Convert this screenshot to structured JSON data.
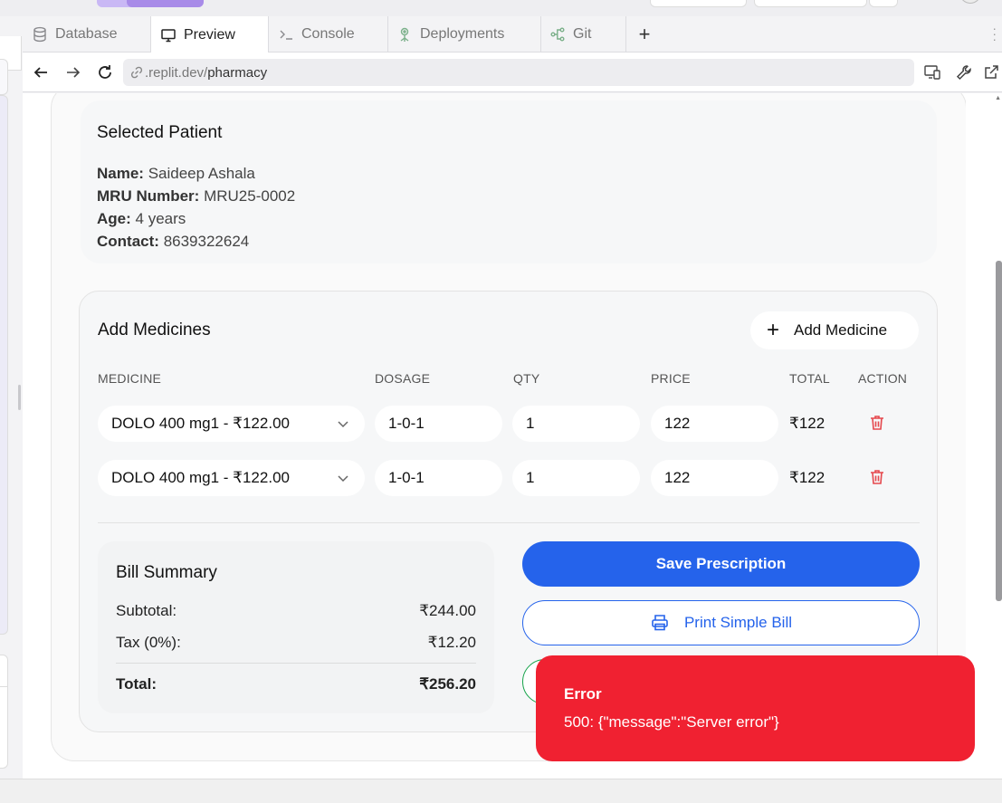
{
  "tabs": [
    {
      "label": "Database",
      "icon": "database-icon"
    },
    {
      "label": "Preview",
      "icon": "monitor-icon"
    },
    {
      "label": "Console",
      "icon": "terminal-icon"
    },
    {
      "label": "Deployments",
      "icon": "deployments-icon"
    },
    {
      "label": "Git",
      "icon": "git-icon"
    }
  ],
  "add_tab": "+",
  "browser": {
    "url_host": ".replit.dev/",
    "url_path": "pharmacy"
  },
  "patient": {
    "heading": "Selected Patient",
    "name_label": "Name:",
    "name": "Saideep Ashala",
    "mru_label": "MRU Number:",
    "mru": "MRU25-0002",
    "age_label": "Age:",
    "age": "4 years",
    "contact_label": "Contact:",
    "contact": "8639322624"
  },
  "medicines": {
    "heading": "Add Medicines",
    "add_button": "Add Medicine",
    "columns": [
      "MEDICINE",
      "DOSAGE",
      "QTY",
      "PRICE",
      "TOTAL",
      "ACTION"
    ],
    "rows": [
      {
        "medicine": "DOLO 400 mg1 - ₹122.00",
        "dosage": "1-0-1",
        "qty": "1",
        "price": "122",
        "total": "₹122"
      },
      {
        "medicine": "DOLO 400 mg1 - ₹122.00",
        "dosage": "1-0-1",
        "qty": "1",
        "price": "122",
        "total": "₹122"
      }
    ]
  },
  "bill": {
    "heading": "Bill Summary",
    "subtotal_label": "Subtotal:",
    "subtotal": "₹244.00",
    "tax_label": "Tax (0%):",
    "tax": "₹12.20",
    "total_label": "Total:",
    "total": "₹256.20"
  },
  "actions": {
    "save": "Save Prescription",
    "print": "Print Simple Bill"
  },
  "toast": {
    "title": "Error",
    "message": "500: {\"message\":\"Server error\"}"
  },
  "colors": {
    "primary": "#2563eb",
    "error": "#f02131",
    "delete": "#e5484d",
    "success_border": "#16a34a"
  }
}
